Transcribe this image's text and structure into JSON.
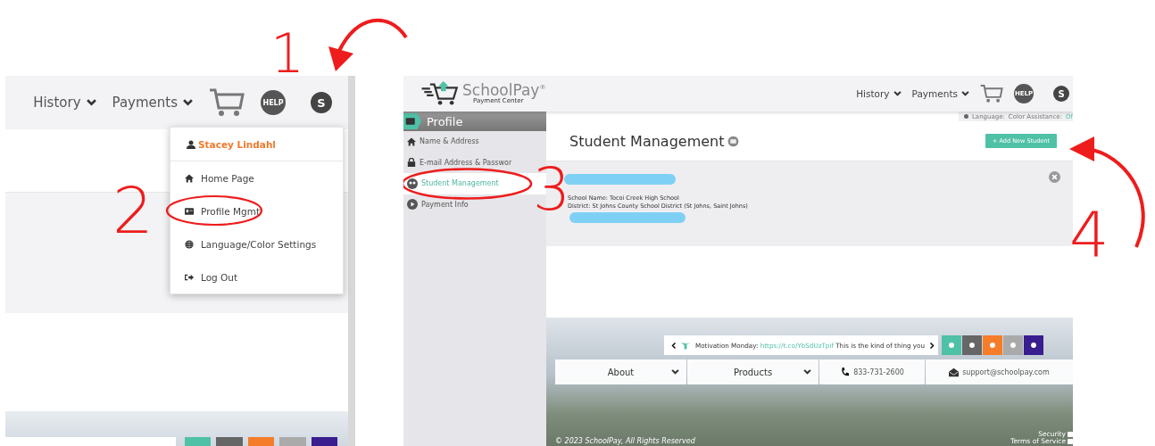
{
  "annotations": {
    "steps": [
      "1",
      "2",
      "3",
      "4"
    ]
  },
  "left_screen": {
    "nav": [
      {
        "label": "History"
      },
      {
        "label": "Payments"
      }
    ],
    "help_label": "HELP",
    "user_initial": "S",
    "menu": {
      "user_name": "Stacey Lindahl",
      "items": [
        {
          "label": "Home Page",
          "circled": false
        },
        {
          "label": "Profile Mgmt",
          "circled": true
        },
        {
          "label": "Language/Color Settings",
          "circled": false
        },
        {
          "label": "Log Out",
          "circled": false
        }
      ]
    }
  },
  "right_screen": {
    "logo": {
      "name": "SchoolPay",
      "mark": "®",
      "subtitle": "Payment Center"
    },
    "nav": [
      {
        "label": "History"
      },
      {
        "label": "Payments"
      }
    ],
    "help_label": "HELP",
    "user_initial": "S",
    "sidebar": {
      "title": "Profile",
      "items": [
        {
          "label": "Name & Address",
          "selected": false,
          "circled": false
        },
        {
          "label": "E-mail Address & Passwor",
          "selected": false,
          "circled": false
        },
        {
          "label": "Student Management",
          "selected": true,
          "circled": true
        },
        {
          "label": "Payment Info",
          "selected": false,
          "circled": false
        }
      ]
    },
    "settings_bar": {
      "language_label": "Language:",
      "color_label": "Color Assistance:",
      "color_value": "Of"
    },
    "page_title": "Student Management",
    "add_button": "+ Add New Student",
    "student": {
      "school": "School Name: Tocoi Creek High School",
      "district": "District: St Johns County School District (St Johns, Saint Johns)"
    },
    "footer": {
      "ticker": {
        "prefix": "Motivation Monday:",
        "link": "https://t.co/YbSdUzTpif",
        "text": "This is the kind of thing you"
      },
      "nav": [
        {
          "label": "About",
          "kind": "dropdown"
        },
        {
          "label": "Products",
          "kind": "dropdown"
        },
        {
          "label": "833-731-2600",
          "kind": "phone"
        },
        {
          "label": "support@schoolpay.com",
          "kind": "email"
        }
      ],
      "copyright": "© 2023 SchoolPay, All Rights Reserved",
      "links": [
        "Security",
        "Terms of Service"
      ]
    }
  }
}
